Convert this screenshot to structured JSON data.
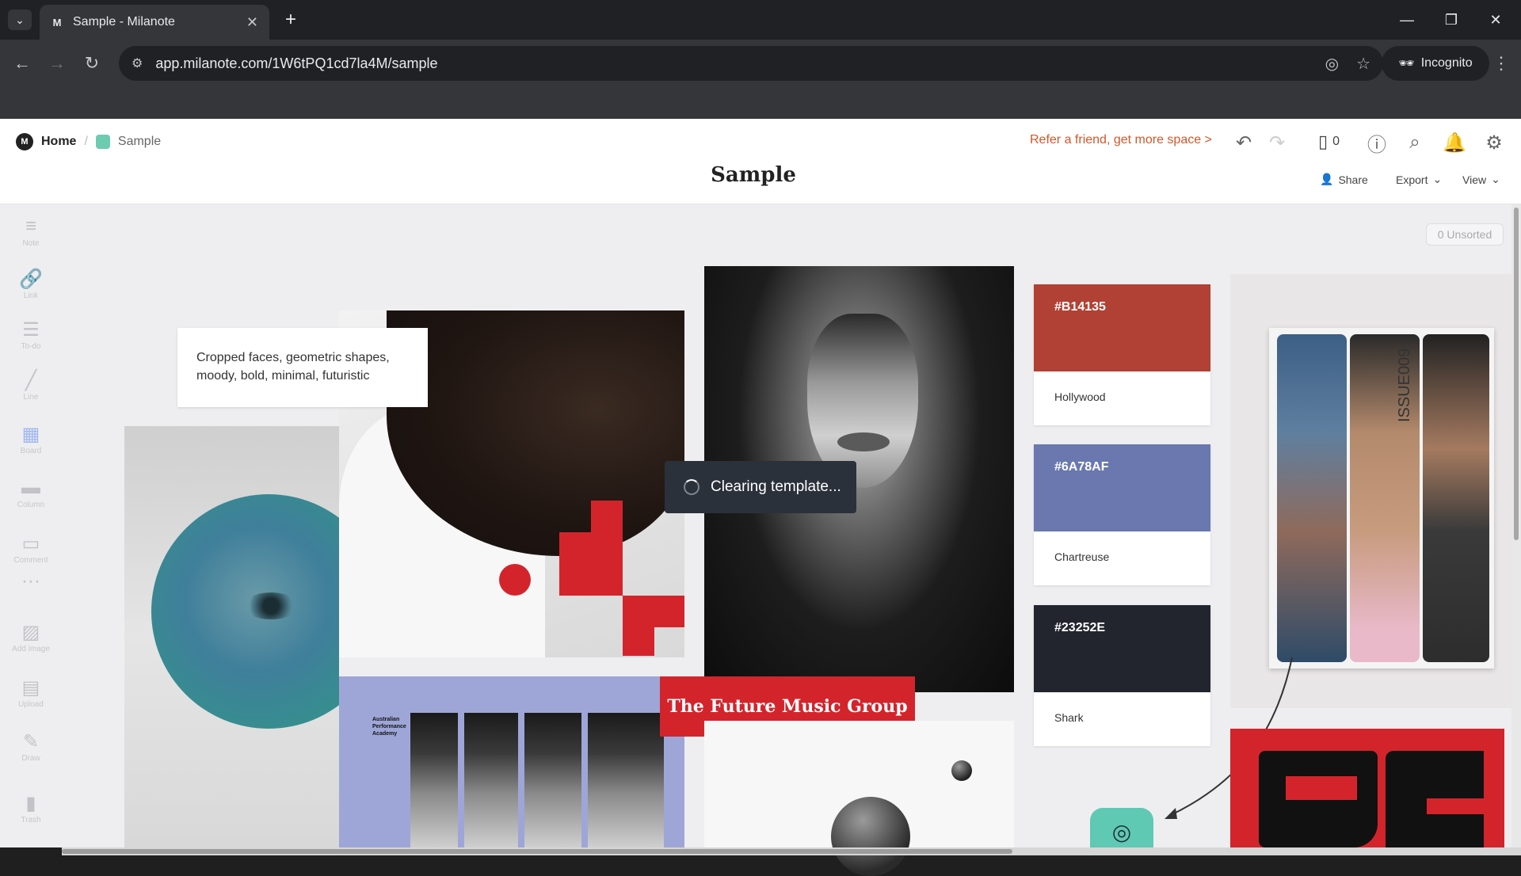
{
  "browser": {
    "tab_title": "Sample - Milanote",
    "url": "app.milanote.com/1W6tPQ1cd7la4M/sample",
    "incognito_label": "Incognito"
  },
  "header": {
    "home_label": "Home",
    "board_crumb": "Sample",
    "refer_text": "Refer a friend, get more space >",
    "device_count": "0",
    "board_title": "Sample",
    "share_label": "Share",
    "export_label": "Export",
    "view_label": "View"
  },
  "toolbar": {
    "tools": [
      {
        "label": "Note",
        "icon": "note-icon"
      },
      {
        "label": "Link",
        "icon": "link-icon"
      },
      {
        "label": "To-do",
        "icon": "todo-icon"
      },
      {
        "label": "Line",
        "icon": "line-icon"
      },
      {
        "label": "Board",
        "icon": "board-icon"
      },
      {
        "label": "Column",
        "icon": "column-icon"
      },
      {
        "label": "Comment",
        "icon": "comment-icon"
      },
      {
        "label": "Add image",
        "icon": "image-icon"
      },
      {
        "label": "Upload",
        "icon": "upload-icon"
      },
      {
        "label": "Draw",
        "icon": "draw-icon"
      },
      {
        "label": "Trash",
        "icon": "trash-icon"
      }
    ]
  },
  "canvas": {
    "unsorted_label": "0 Unsorted",
    "note_text": "Cropped faces, geometric shapes, moody, bold, minimal, futuristic",
    "loading_text": "Clearing template...",
    "swatches": [
      {
        "hex": "#B14135",
        "name": "Hollywood",
        "color": "#B14135"
      },
      {
        "hex": "#6A78AF",
        "name": "Chartreuse",
        "color": "#6A78AF"
      },
      {
        "hex": "#23252E",
        "name": "Shark",
        "color": "#23252E"
      }
    ],
    "future_label": "The Future Music Group",
    "poster_small_text": "Australian Performance Academy",
    "magazine_issue": "ISSUE009"
  }
}
